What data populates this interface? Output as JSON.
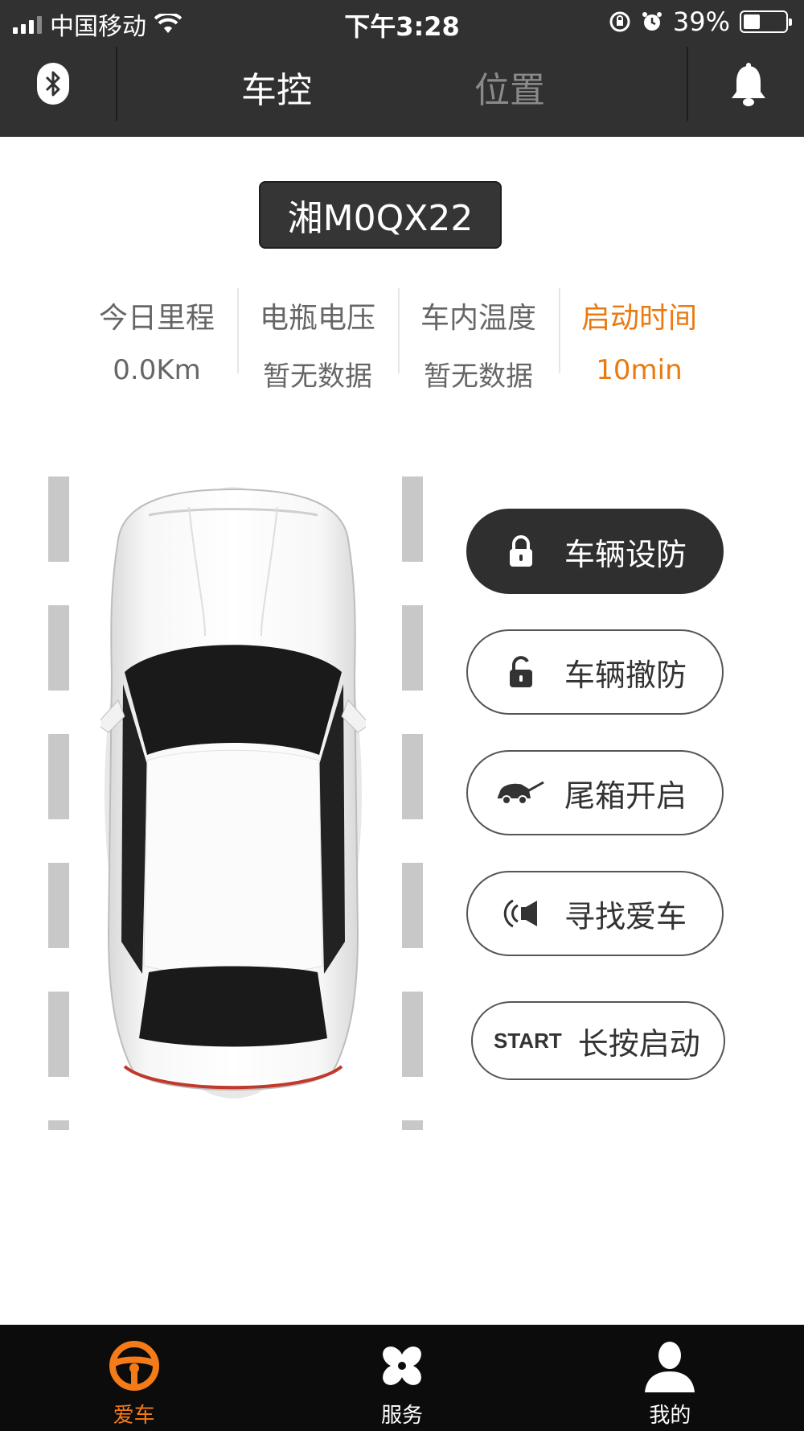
{
  "status_bar": {
    "carrier": "中国移动",
    "time": "下午3:28",
    "battery": "39%"
  },
  "header": {
    "tabs": [
      {
        "label": "车控",
        "active": true
      },
      {
        "label": "位置",
        "active": false
      }
    ],
    "left_icon": "bluetooth-icon",
    "right_icon": "bell-icon"
  },
  "vehicle": {
    "plate": "湘M0QX22"
  },
  "stats": [
    {
      "label": "今日里程",
      "value": "0.0Km",
      "highlight": false
    },
    {
      "label": "电瓶电压",
      "value": "暂无数据",
      "highlight": false
    },
    {
      "label": "车内温度",
      "value": "暂无数据",
      "highlight": false
    },
    {
      "label": "启动时间",
      "value": "10min",
      "highlight": true
    }
  ],
  "actions": [
    {
      "label": "车辆设防",
      "icon": "lock-icon",
      "style": "dark"
    },
    {
      "label": "车辆撤防",
      "icon": "unlock-icon",
      "style": "outline"
    },
    {
      "label": "尾箱开启",
      "icon": "car-trunk-icon",
      "style": "outline"
    },
    {
      "label": "寻找爱车",
      "icon": "horn-icon",
      "style": "outline"
    },
    {
      "label": "长按启动",
      "icon_text": "START",
      "style": "outline"
    }
  ],
  "bottom_nav": [
    {
      "label": "爱车",
      "icon": "steering-wheel-icon",
      "active": true
    },
    {
      "label": "服务",
      "icon": "clover-icon",
      "active": false
    },
    {
      "label": "我的",
      "icon": "person-icon",
      "active": false
    }
  ],
  "colors": {
    "header_bg": "#313131",
    "accent": "#ea7a10",
    "nav_bg": "#0c0c0c"
  }
}
